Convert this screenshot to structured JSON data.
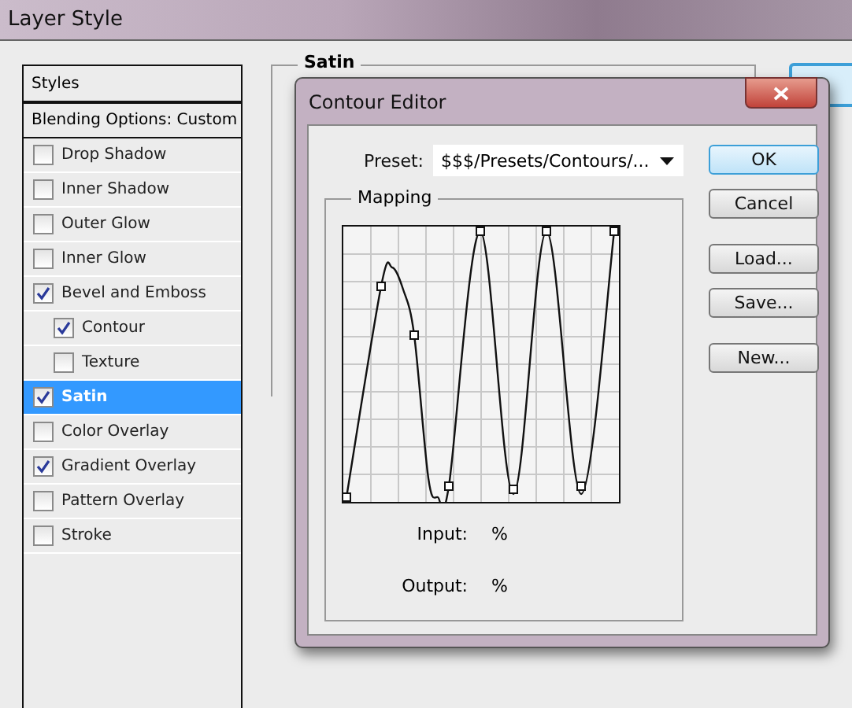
{
  "window": {
    "title": "Layer Style"
  },
  "styles_panel": {
    "header": "Styles",
    "blending": "Blending Options: Custom",
    "items": [
      {
        "label": "Drop Shadow",
        "checked": false,
        "selected": false
      },
      {
        "label": "Inner Shadow",
        "checked": false,
        "selected": false
      },
      {
        "label": "Outer Glow",
        "checked": false,
        "selected": false
      },
      {
        "label": "Inner Glow",
        "checked": false,
        "selected": false
      },
      {
        "label": "Bevel and Emboss",
        "checked": true,
        "selected": false,
        "children": [
          {
            "label": "Contour",
            "checked": true,
            "selected": false
          },
          {
            "label": "Texture",
            "checked": false,
            "selected": false
          }
        ]
      },
      {
        "label": "Satin",
        "checked": true,
        "selected": true
      },
      {
        "label": "Color Overlay",
        "checked": false,
        "selected": false
      },
      {
        "label": "Gradient Overlay",
        "checked": true,
        "selected": false
      },
      {
        "label": "Pattern Overlay",
        "checked": false,
        "selected": false
      },
      {
        "label": "Stroke",
        "checked": false,
        "selected": false
      }
    ]
  },
  "satin_group": {
    "title": "Satin"
  },
  "contour_editor": {
    "title": "Contour Editor",
    "preset": {
      "label": "Preset:",
      "value": "$$$/Presets/Contours/..."
    },
    "mapping": {
      "title": "Mapping",
      "input": {
        "label": "Input:",
        "value": "%"
      },
      "output": {
        "label": "Output:",
        "value": "%"
      }
    },
    "buttons": [
      {
        "label": "OK",
        "default": true
      },
      {
        "label": "Cancel",
        "default": false
      },
      {
        "label": "Load...",
        "default": false
      },
      {
        "label": "Save...",
        "default": false
      },
      {
        "label": "New...",
        "default": false
      }
    ]
  }
}
